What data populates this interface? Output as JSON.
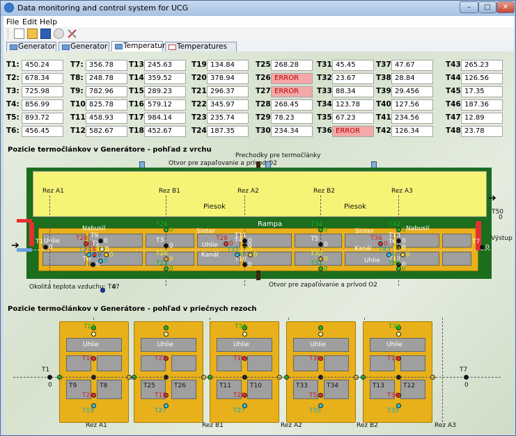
{
  "window": {
    "title": "Data monitoring and control system for UCG",
    "min": "–",
    "max": "□",
    "close": "✕"
  },
  "menu": [
    "File",
    "Edit",
    "Help"
  ],
  "toolbar_icons": [
    "new-file-icon",
    "open-folder-icon",
    "save-icon",
    "stop-icon",
    "tools-icon"
  ],
  "tabs": [
    {
      "label": "Generator 1",
      "icon": "monitor-icon"
    },
    {
      "label": "Generator 2",
      "icon": "monitor-icon"
    },
    {
      "label": "Temperatures",
      "icon": "monitor-icon",
      "active": true
    },
    {
      "label": "Temperatures trends",
      "icon": "chart-icon"
    }
  ],
  "temperatures": [
    {
      "l": "T1:",
      "v": "450.24"
    },
    {
      "l": "T2:",
      "v": "678.34"
    },
    {
      "l": "T3:",
      "v": "725.98"
    },
    {
      "l": "T4:",
      "v": "856.99"
    },
    {
      "l": "T5:",
      "v": "893.72"
    },
    {
      "l": "T6:",
      "v": "456.45"
    },
    {
      "l": "T7:",
      "v": "356.78"
    },
    {
      "l": "T8:",
      "v": "248.78"
    },
    {
      "l": "T9:",
      "v": "782.96"
    },
    {
      "l": "T10:",
      "v": "825.78"
    },
    {
      "l": "T11:",
      "v": "458.93"
    },
    {
      "l": "T12:",
      "v": "582.67"
    },
    {
      "l": "T13:",
      "v": "245.63"
    },
    {
      "l": "T14:",
      "v": "359.52"
    },
    {
      "l": "T15:",
      "v": "289.23"
    },
    {
      "l": "T16:",
      "v": "579.12"
    },
    {
      "l": "T17:",
      "v": "984.14"
    },
    {
      "l": "T18:",
      "v": "452.67"
    },
    {
      "l": "T19:",
      "v": "134.84"
    },
    {
      "l": "T20:",
      "v": "378.94"
    },
    {
      "l": "T21:",
      "v": "296.37"
    },
    {
      "l": "T22:",
      "v": "345.97"
    },
    {
      "l": "T23:",
      "v": "235.74"
    },
    {
      "l": "T24:",
      "v": "187.35"
    },
    {
      "l": "T25:",
      "v": "268.28"
    },
    {
      "l": "T26:",
      "v": "ERROR",
      "err": true
    },
    {
      "l": "T27:",
      "v": "ERROR",
      "err": true
    },
    {
      "l": "T28:",
      "v": "268.45"
    },
    {
      "l": "T29:",
      "v": "78.23"
    },
    {
      "l": "T30:",
      "v": "234.34"
    },
    {
      "l": "T31:",
      "v": "45.45"
    },
    {
      "l": "T32:",
      "v": "23.67"
    },
    {
      "l": "T33:",
      "v": "88.34"
    },
    {
      "l": "T34:",
      "v": "123.78"
    },
    {
      "l": "T35:",
      "v": "67.23"
    },
    {
      "l": "T36:",
      "v": "ERROR",
      "err": true
    },
    {
      "l": "T37:",
      "v": "47.67"
    },
    {
      "l": "T38:",
      "v": "28.84"
    },
    {
      "l": "T39:",
      "v": "29.456"
    },
    {
      "l": "T40:",
      "v": "127.56"
    },
    {
      "l": "T41:",
      "v": "234.56"
    },
    {
      "l": "T42:",
      "v": "126.34"
    },
    {
      "l": "T43:",
      "v": "265.23"
    },
    {
      "l": "T44:",
      "v": "126.56"
    },
    {
      "l": "T45:",
      "v": "17.35"
    },
    {
      "l": "T46:",
      "v": "187.36"
    },
    {
      "l": "T47:",
      "v": "12.89"
    },
    {
      "l": "T48:",
      "v": "23.78"
    }
  ],
  "top_view": {
    "title": "Pozicie termočlánkov v Generátore - pohľad z vrchu",
    "prechodky": "Prechodky pre termočlánky",
    "otvor_top": "Otvor pre zapaľovanie a prívod O2",
    "otvor_bottom": "Otvor pre zapaľovanie a prívod O2",
    "rez": [
      "Rez A1",
      "Rez B1",
      "Rez A2",
      "Rez B2",
      "Rez A3"
    ],
    "piesok": [
      "Piesok",
      "Piesok"
    ],
    "rampa": "Rampa",
    "vystup": "Výstup",
    "t50": "T50",
    "t50_val": "0",
    "uhlie": [
      "Uhlie",
      "Uhlie",
      "Uhlie"
    ],
    "kanal": [
      "Kanál",
      "Kanál"
    ],
    "nabusil": [
      "Nabusil",
      "Nabusil"
    ],
    "sinter": [
      "Sinter",
      "Sinter"
    ],
    "okolita": "Okolitá teplota vzduchu: T47",
    "okolita_val": "0",
    "sensors": [
      {
        "n": "T1",
        "v": "0",
        "c": "t-white"
      },
      {
        "n": "T7",
        "v": "0",
        "c": "t-white"
      },
      {
        "n": "T2",
        "v": "0",
        "c": "t-white"
      },
      {
        "n": "T3",
        "v": "0",
        "c": "t-white"
      },
      {
        "n": "T4",
        "v": "0",
        "c": "t-white"
      },
      {
        "n": "T5",
        "v": "0",
        "c": "t-white"
      },
      {
        "n": "T6",
        "v": "0",
        "c": "t-white"
      },
      {
        "n": "T8",
        "v": "0",
        "c": "t-white"
      },
      {
        "n": "T9",
        "v": "0",
        "c": "t-white"
      },
      {
        "n": "T10",
        "v": "0",
        "c": "t-white"
      },
      {
        "n": "T11",
        "v": "0",
        "c": "t-white"
      },
      {
        "n": "T12",
        "v": "0",
        "c": "t-white"
      },
      {
        "n": "T13",
        "v": "0",
        "c": "t-white"
      },
      {
        "n": "T20",
        "v": "0",
        "c": "t-red"
      },
      {
        "n": "T28",
        "v": "0",
        "c": "t-red"
      },
      {
        "n": "T36",
        "v": "0",
        "c": "t-red"
      },
      {
        "n": "T21",
        "v": "0",
        "c": "t-yellow"
      },
      {
        "n": "T29",
        "v": "0",
        "c": "t-yellow"
      },
      {
        "n": "T37",
        "v": "0",
        "c": "t-yellow"
      },
      {
        "n": "T26",
        "v": "0",
        "c": "t-green"
      },
      {
        "n": "T34",
        "v": "0",
        "c": "t-green"
      },
      {
        "n": "T42",
        "v": "0",
        "c": "t-green"
      },
      {
        "n": "T23",
        "v": "0",
        "c": "t-green"
      },
      {
        "n": "T31",
        "v": "0",
        "c": "t-green"
      },
      {
        "n": "T39",
        "v": "0",
        "c": "t-green"
      },
      {
        "n": "T24",
        "v": "0",
        "c": "t-yellow"
      },
      {
        "n": "T32",
        "v": "0",
        "c": "t-yellow"
      },
      {
        "n": "T27",
        "v": "0",
        "c": "t-cyan"
      },
      {
        "n": "T35",
        "v": "0",
        "c": "t-cyan"
      },
      {
        "n": "T43",
        "v": "0",
        "c": "t-cyan"
      },
      {
        "n": "T14",
        "v": "0",
        "c": "t-red"
      },
      {
        "n": "T19",
        "v": "0",
        "c": "t-cyan"
      }
    ]
  },
  "cross_view": {
    "title": "Pozicie termočlánkov v Generátore - pohľad v priečnych rezoch",
    "rez": [
      "Rez A1",
      "Rez B1",
      "Rez A2",
      "Rez B2",
      "Rez A3"
    ],
    "uhlie": [
      "Uhlie",
      "Uhlie",
      "Uhlie",
      "Uhlie",
      "Uhlie"
    ],
    "t1": "T1",
    "t1_val": "0",
    "t7": "T7",
    "t7_val": "0",
    "sections": [
      {
        "top": "T22",
        "r1": "T2",
        "mid_l": "T14",
        "mid_r": "T14",
        "bl": "T9",
        "br": "T8",
        "red": "T20",
        "cyan": "T19",
        "green": "T21"
      },
      {
        "top": "",
        "r1": "",
        "mid_l": "T23",
        "mid_r": "T24",
        "bl": "T25",
        "br": "T26",
        "red": "T15",
        "cyan": "T27",
        "green": "T23"
      },
      {
        "top": "T30",
        "r1": "T29",
        "mid_l": "T16",
        "mid_r": "T16",
        "bl": "T11",
        "br": "T10",
        "red": "T28",
        "cyan": "T27",
        "green": "T29"
      },
      {
        "top": "",
        "r1": "",
        "mid_l": "T31",
        "mid_r": "T32",
        "bl": "T33",
        "br": "T34",
        "red": "T5",
        "cyan": "T35",
        "green": "T31"
      },
      {
        "top": "T38",
        "r1": "T37",
        "mid_l": "T18",
        "mid_r": "T18",
        "bl": "T13",
        "br": "T12",
        "red": "T36",
        "cyan": "T35",
        "green": "T37"
      }
    ]
  }
}
